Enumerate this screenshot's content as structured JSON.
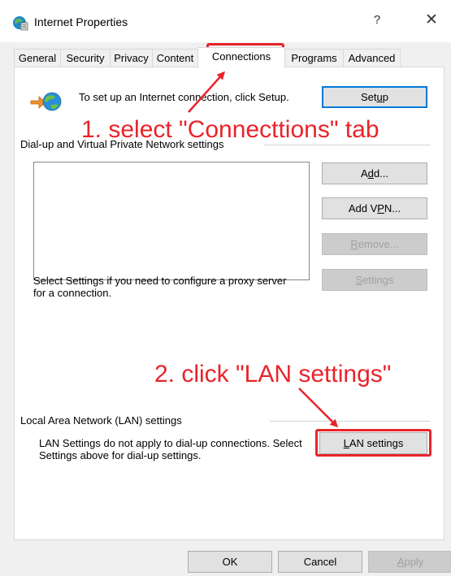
{
  "window": {
    "title": "Internet Properties",
    "help_label": "?",
    "close_label": "✕"
  },
  "tabs": [
    {
      "label": "General"
    },
    {
      "label": "Security"
    },
    {
      "label": "Privacy"
    },
    {
      "label": "Content"
    },
    {
      "label": "Connections",
      "active": true
    },
    {
      "label": "Programs"
    },
    {
      "label": "Advanced"
    }
  ],
  "setup": {
    "description": "To set up an Internet connection, click Setup.",
    "button_pre": "Set",
    "button_key": "u",
    "button_post": "p"
  },
  "dialup": {
    "group_label": "Dial-up and Virtual Private Network settings",
    "add_pre": "A",
    "add_key": "d",
    "add_post": "d...",
    "addvpn_pre": "Add V",
    "addvpn_key": "P",
    "addvpn_post": "N...",
    "remove_pre": "",
    "remove_key": "R",
    "remove_post": "emove...",
    "proxy_text": "Select Settings if you need to configure a proxy server for a connection.",
    "settings_pre": "",
    "settings_key": "S",
    "settings_post": "ettings"
  },
  "lan": {
    "group_label": "Local Area Network (LAN) settings",
    "info_text": "LAN Settings do not apply to dial-up connections. Select Settings above for dial-up settings.",
    "button_pre": "",
    "button_key": "L",
    "button_post": "AN settings"
  },
  "annotations": {
    "step1": "1. select \"Connecttions\" tab",
    "step2": "2. click \"LAN settings\"",
    "color": "#e8242b"
  },
  "footer": {
    "ok_label": "OK",
    "cancel_label": "Cancel",
    "apply_pre": "",
    "apply_key": "A",
    "apply_post": "pply"
  }
}
